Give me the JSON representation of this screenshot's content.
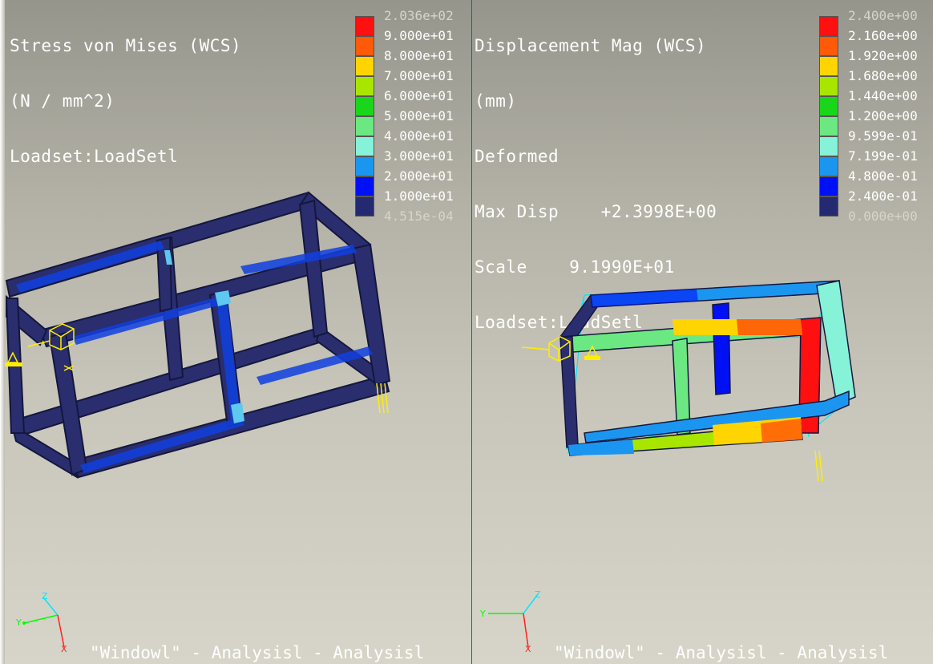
{
  "left_view": {
    "title_lines": [
      "Stress von Mises (WCS)",
      "(N / mm^2)",
      "Loadset:LoadSetl"
    ],
    "legend": [
      {
        "label": "2.036e+02",
        "color": "#ff1010",
        "dim": true
      },
      {
        "label": "9.000e+01",
        "color": "#ff5a08",
        "dim": false
      },
      {
        "label": "8.000e+01",
        "color": "#ffd400",
        "dim": false
      },
      {
        "label": "7.000e+01",
        "color": "#a8e600",
        "dim": false
      },
      {
        "label": "6.000e+01",
        "color": "#1ad61a",
        "dim": false
      },
      {
        "label": "5.000e+01",
        "color": "#6be882",
        "dim": false
      },
      {
        "label": "4.000e+01",
        "color": "#86f2d8",
        "dim": false
      },
      {
        "label": "3.000e+01",
        "color": "#1b96f0",
        "dim": false
      },
      {
        "label": "2.000e+01",
        "color": "#0010f5",
        "dim": false
      },
      {
        "label": "1.000e+01",
        "color": "#232a72",
        "dim": false
      },
      {
        "label": "4.515e-04",
        "color": null,
        "dim": true
      }
    ],
    "footer": "\"Windowl\" - Analysisl - Analysisl",
    "triad_labels": [
      "Z",
      "Y",
      "X"
    ]
  },
  "right_view": {
    "title_lines": [
      "Displacement Mag (WCS)",
      "(mm)",
      "Deformed",
      "Max Disp    +2.3998E+00",
      "Scale    9.1990E+01",
      "Loadset:LoadSetl"
    ],
    "legend": [
      {
        "label": "2.400e+00",
        "color": "#ff1010",
        "dim": true
      },
      {
        "label": "2.160e+00",
        "color": "#ff5a08",
        "dim": false
      },
      {
        "label": "1.920e+00",
        "color": "#ffd400",
        "dim": false
      },
      {
        "label": "1.680e+00",
        "color": "#a8e600",
        "dim": false
      },
      {
        "label": "1.440e+00",
        "color": "#1ad61a",
        "dim": false
      },
      {
        "label": "1.200e+00",
        "color": "#6be882",
        "dim": false
      },
      {
        "label": "9.599e-01",
        "color": "#86f2d8",
        "dim": false
      },
      {
        "label": "7.199e-01",
        "color": "#1b96f0",
        "dim": false
      },
      {
        "label": "4.800e-01",
        "color": "#0010f5",
        "dim": false
      },
      {
        "label": "2.400e-01",
        "color": "#232a72",
        "dim": false
      },
      {
        "label": "0.000e+00",
        "color": null,
        "dim": true
      }
    ],
    "footer": "\"Windowl\" - Analysisl - Analysisl",
    "triad_labels": [
      "Z",
      "Y",
      "X"
    ]
  },
  "colors": {
    "divider": "#d02020",
    "frame_dark": "#2a2e6e",
    "constraint": "#ffee00",
    "undeformed_outline": "#00e5ff"
  }
}
